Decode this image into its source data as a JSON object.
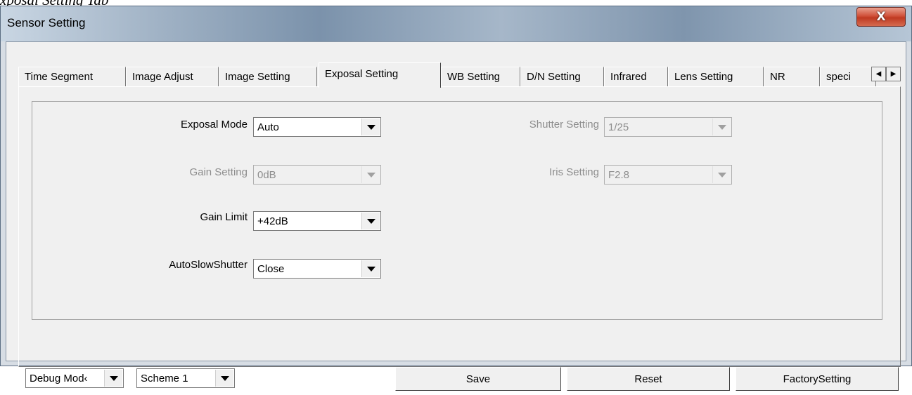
{
  "caption": "xposal Setting Tab",
  "window": {
    "title": "Sensor Setting",
    "close_glyph": "X"
  },
  "tabs": [
    {
      "label": "Time Segment"
    },
    {
      "label": "Image Adjust"
    },
    {
      "label": "Image Setting"
    },
    {
      "label": "Exposal Setting",
      "active": true
    },
    {
      "label": "WB Setting"
    },
    {
      "label": "D/N Setting"
    },
    {
      "label": "Infrared"
    },
    {
      "label": "Lens Setting"
    },
    {
      "label": "NR"
    },
    {
      "label": "speci"
    }
  ],
  "tab_scroll": {
    "left_icon": "triangle-left-icon",
    "right_icon": "triangle-right-icon"
  },
  "exposal": {
    "exposal_mode": {
      "label": "Exposal Mode",
      "value": "Auto",
      "enabled": true
    },
    "gain_setting": {
      "label": "Gain Setting",
      "value": "0dB",
      "enabled": false
    },
    "gain_limit": {
      "label": "Gain Limit",
      "value": "+42dB",
      "enabled": true
    },
    "auto_slow_shutter": {
      "label": "AutoSlowShutter",
      "value": "Close",
      "enabled": true
    },
    "shutter_setting": {
      "label": "Shutter Setting",
      "value": "1/25",
      "enabled": false
    },
    "iris_setting": {
      "label": "Iris Setting",
      "value": "F2.8",
      "enabled": false
    }
  },
  "bottom": {
    "debug_mode": "Debug Mod‹",
    "scheme": "Scheme 1",
    "save": "Save",
    "reset": "Reset",
    "factory": "FactorySetting"
  }
}
